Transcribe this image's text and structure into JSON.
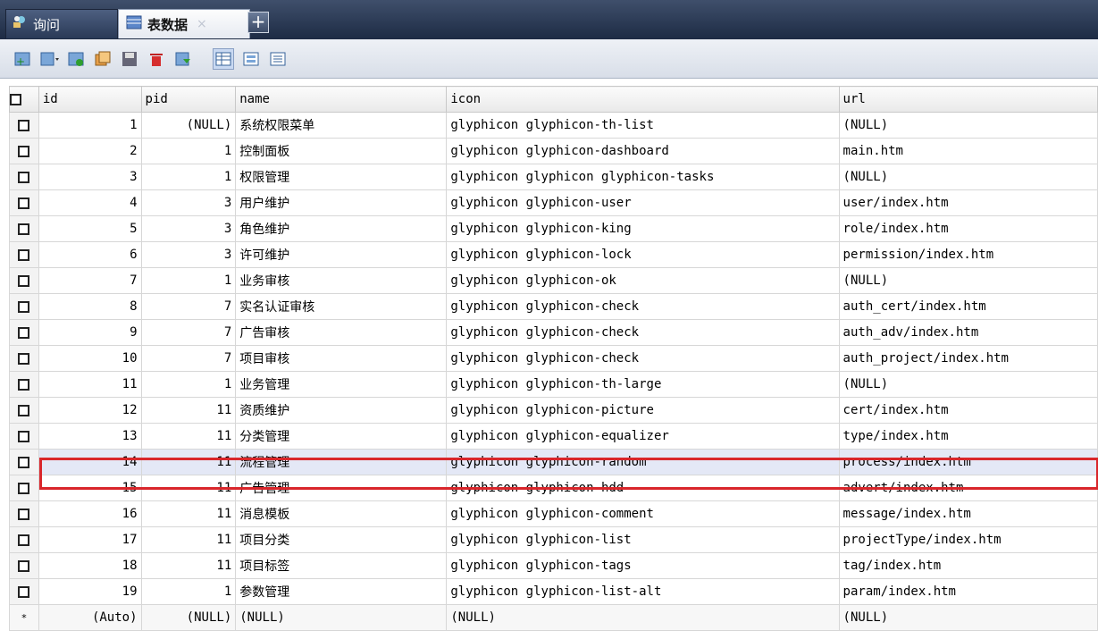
{
  "tabs": {
    "query_label": "询问",
    "table_label": "表数据",
    "close_glyph": "×",
    "add_glyph": "+"
  },
  "toolbar": {
    "buttons": [
      "add-record-icon",
      "export-icon",
      "new-record-icon",
      "copy-record-icon",
      "save-icon",
      "delete-icon",
      "refresh-icon",
      "grid-view-icon",
      "form-view-icon",
      "text-view-icon"
    ]
  },
  "grid": {
    "columns": [
      "id",
      "pid",
      "name",
      "icon",
      "url"
    ],
    "rows": [
      {
        "id": "1",
        "pid": "(NULL)",
        "name": "系统权限菜单",
        "icon": "glyphicon glyphicon-th-list",
        "url": "(NULL)"
      },
      {
        "id": "2",
        "pid": "1",
        "name": "控制面板",
        "icon": "glyphicon glyphicon-dashboard",
        "url": "main.htm"
      },
      {
        "id": "3",
        "pid": "1",
        "name": "权限管理",
        "icon": "glyphicon glyphicon glyphicon-tasks",
        "url": "(NULL)"
      },
      {
        "id": "4",
        "pid": "3",
        "name": "用户维护",
        "icon": "glyphicon glyphicon-user",
        "url": "user/index.htm"
      },
      {
        "id": "5",
        "pid": "3",
        "name": "角色维护",
        "icon": "glyphicon glyphicon-king",
        "url": "role/index.htm"
      },
      {
        "id": "6",
        "pid": "3",
        "name": "许可维护",
        "icon": "glyphicon glyphicon-lock",
        "url": "permission/index.htm"
      },
      {
        "id": "7",
        "pid": "1",
        "name": "业务审核",
        "icon": "glyphicon glyphicon-ok",
        "url": "(NULL)"
      },
      {
        "id": "8",
        "pid": "7",
        "name": "实名认证审核",
        "icon": "glyphicon glyphicon-check",
        "url": "auth_cert/index.htm"
      },
      {
        "id": "9",
        "pid": "7",
        "name": "广告审核",
        "icon": "glyphicon glyphicon-check",
        "url": "auth_adv/index.htm"
      },
      {
        "id": "10",
        "pid": "7",
        "name": "项目审核",
        "icon": "glyphicon glyphicon-check",
        "url": "auth_project/index.htm"
      },
      {
        "id": "11",
        "pid": "1",
        "name": "业务管理",
        "icon": "glyphicon glyphicon-th-large",
        "url": "(NULL)"
      },
      {
        "id": "12",
        "pid": "11",
        "name": "资质维护",
        "icon": "glyphicon glyphicon-picture",
        "url": "cert/index.htm"
      },
      {
        "id": "13",
        "pid": "11",
        "name": "分类管理",
        "icon": "glyphicon glyphicon-equalizer",
        "url": "type/index.htm"
      },
      {
        "id": "14",
        "pid": "11",
        "name": "流程管理",
        "icon": "glyphicon glyphicon-random",
        "url": "process/index.htm"
      },
      {
        "id": "15",
        "pid": "11",
        "name": "广告管理",
        "icon": "glyphicon glyphicon-hdd",
        "url": "advert/index.htm"
      },
      {
        "id": "16",
        "pid": "11",
        "name": "消息模板",
        "icon": "glyphicon glyphicon-comment",
        "url": "message/index.htm"
      },
      {
        "id": "17",
        "pid": "11",
        "name": "项目分类",
        "icon": "glyphicon glyphicon-list",
        "url": "projectType/index.htm"
      },
      {
        "id": "18",
        "pid": "11",
        "name": "项目标签",
        "icon": "glyphicon glyphicon-tags",
        "url": "tag/index.htm"
      },
      {
        "id": "19",
        "pid": "1",
        "name": "参数管理",
        "icon": "glyphicon glyphicon-list-alt",
        "url": "param/index.htm"
      }
    ],
    "new_row": {
      "marker": "*",
      "id": "(Auto)",
      "pid": "(NULL)",
      "name": "(NULL)",
      "icon": "(NULL)",
      "url": "(NULL)"
    },
    "highlight_color": "#d9262b"
  }
}
